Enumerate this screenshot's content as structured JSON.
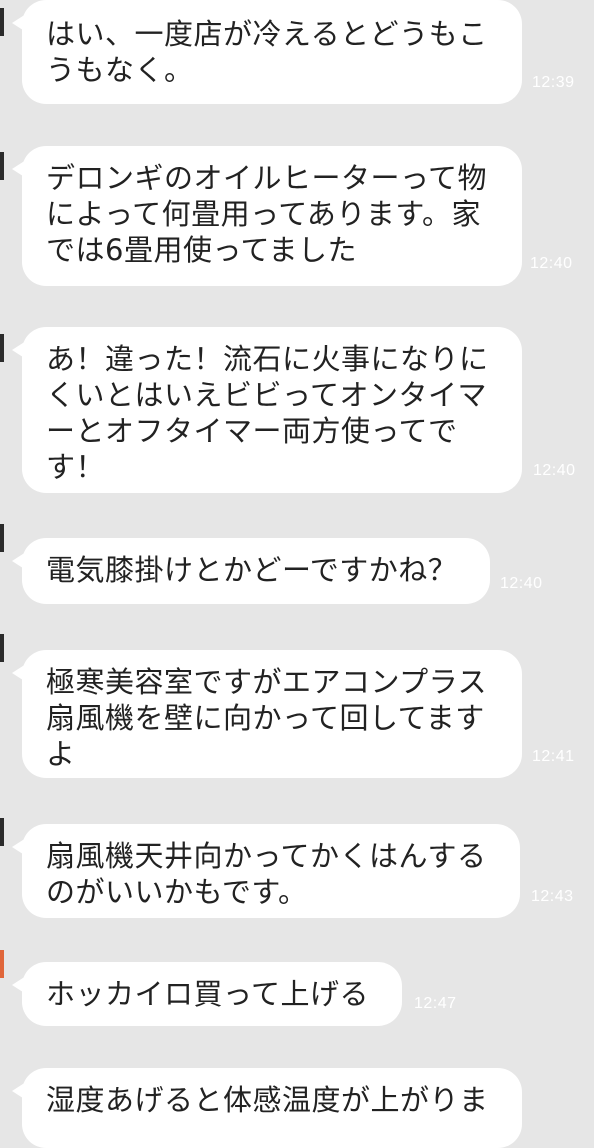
{
  "messages": [
    {
      "text": "はい、一度店が冷えるとどうもこうもなく。",
      "time": "12:39"
    },
    {
      "text": "デロンギのオイルヒーターって物によって何畳用ってあります。家では6畳用使ってました",
      "time": "12:40"
    },
    {
      "text": "あ！違った！流石に火事になりにくいとはいえビビってオンタイマーとオフタイマー両方使ってです！",
      "time": "12:40"
    },
    {
      "text": "電気膝掛けとかどーですかね？",
      "time": "12:40"
    },
    {
      "text": "極寒美容室ですがエアコンプラス扇風機を壁に向かって回してますよ",
      "time": "12:41"
    },
    {
      "text": "扇風機天井向かってかくはんするのがいいかもです。",
      "time": "12:43"
    },
    {
      "text": "ホッカイロ買って上げる",
      "time": "12:47"
    },
    {
      "text": "湿度あげると体感温度が上がりま",
      "time": ""
    }
  ]
}
